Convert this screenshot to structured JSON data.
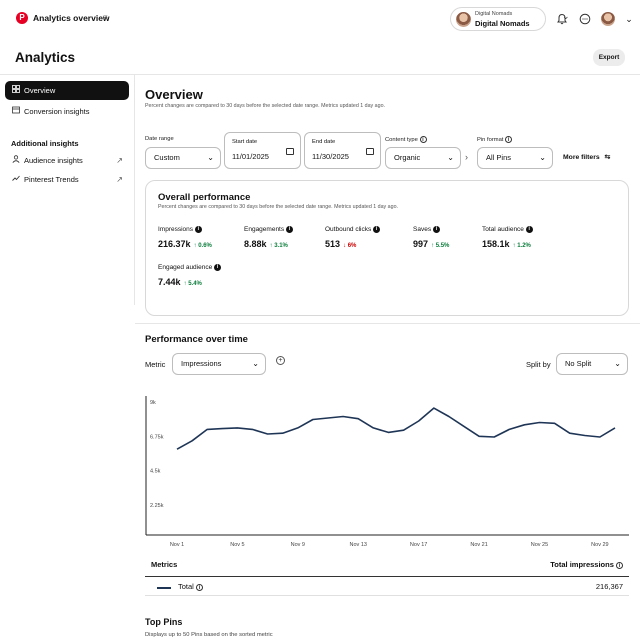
{
  "app": {
    "title": "Analytics overview",
    "page_title": "Analytics",
    "export_label": "Export"
  },
  "account": {
    "small_label": "Digital Nomads",
    "name": "Digital Nomads"
  },
  "icons": {
    "brand_color": "#e60023"
  },
  "sidebar": {
    "items": [
      {
        "label": "Overview",
        "icon": "grid-icon",
        "active": true
      },
      {
        "label": "Conversion insights",
        "icon": "conversion-icon",
        "active": false
      }
    ],
    "section_title": "Additional insights",
    "extra_items": [
      {
        "label": "Audience insights",
        "icon": "person-icon"
      },
      {
        "label": "Pinterest Trends",
        "icon": "trend-icon"
      }
    ]
  },
  "overview": {
    "title": "Overview",
    "subtitle": "Percent changes are compared to 30 days before the selected date range. Metrics updated 1 day ago."
  },
  "filters": {
    "date_range_label": "Date range",
    "date_range_value": "Custom",
    "start_date_label": "Start date",
    "start_date_value": "11/01/2025",
    "end_date_label": "End date",
    "end_date_value": "11/30/2025",
    "content_type_label": "Content type",
    "content_type_value": "Organic",
    "pin_format_label": "Pin format",
    "pin_format_value": "All Pins",
    "more_filters": "More filters"
  },
  "overall": {
    "title": "Overall performance",
    "subtitle": "Percent changes are compared to 30 days before the selected date range. Metrics updated 1 day ago.",
    "metrics": [
      {
        "label": "Impressions",
        "value": "216.37k",
        "change": "0.6%",
        "direction": "up"
      },
      {
        "label": "Engagements",
        "value": "8.88k",
        "change": "3.1%",
        "direction": "up"
      },
      {
        "label": "Outbound clicks",
        "value": "513",
        "change": "6%",
        "direction": "down"
      },
      {
        "label": "Saves",
        "value": "997",
        "change": "5.5%",
        "direction": "up"
      },
      {
        "label": "Total audience",
        "value": "158.1k",
        "change": "1.2%",
        "direction": "up"
      },
      {
        "label": "Engaged audience",
        "value": "7.44k",
        "change": "5.4%",
        "direction": "up"
      }
    ]
  },
  "performance": {
    "title": "Performance over time",
    "metric_label": "Metric",
    "metric_value": "Impressions",
    "split_label": "Split by",
    "split_value": "No Split"
  },
  "chart_data": {
    "type": "line",
    "x": [
      "Nov 1",
      "Nov 2",
      "Nov 3",
      "Nov 4",
      "Nov 5",
      "Nov 6",
      "Nov 7",
      "Nov 8",
      "Nov 9",
      "Nov 10",
      "Nov 11",
      "Nov 12",
      "Nov 13",
      "Nov 14",
      "Nov 15",
      "Nov 16",
      "Nov 17",
      "Nov 18",
      "Nov 19",
      "Nov 20",
      "Nov 21",
      "Nov 22",
      "Nov 23",
      "Nov 24",
      "Nov 25",
      "Nov 26",
      "Nov 27",
      "Nov 28",
      "Nov 29",
      "Nov 30"
    ],
    "x_tick_labels": [
      "Nov 1",
      "Nov 5",
      "Nov 9",
      "Nov 13",
      "Nov 17",
      "Nov 21",
      "Nov 25",
      "Nov 29"
    ],
    "series": [
      {
        "name": "Total",
        "color": "#1f3556",
        "values": [
          5900,
          6450,
          7200,
          7250,
          7300,
          7200,
          6900,
          6950,
          7300,
          7850,
          7950,
          8050,
          7900,
          7300,
          7000,
          7150,
          7750,
          8600,
          8050,
          7400,
          6750,
          6700,
          7200,
          7500,
          7650,
          7600,
          6950,
          6800,
          6700,
          7300
        ]
      }
    ],
    "y_ticks": [
      2250,
      4500,
      6750,
      9000
    ],
    "y_tick_labels": [
      "2.25k",
      "4.5k",
      "6.75k",
      "9k"
    ],
    "ylim": [
      0,
      9000
    ],
    "grid": false,
    "title": "",
    "xlabel": "",
    "ylabel": ""
  },
  "metrics_table": {
    "header_left": "Metrics",
    "header_right": "Total impressions",
    "row_label": "Total",
    "row_value": "216,367"
  },
  "top_pins": {
    "title": "Top Pins",
    "subtitle": "Displays up to 50 Pins based on the sorted metric"
  }
}
